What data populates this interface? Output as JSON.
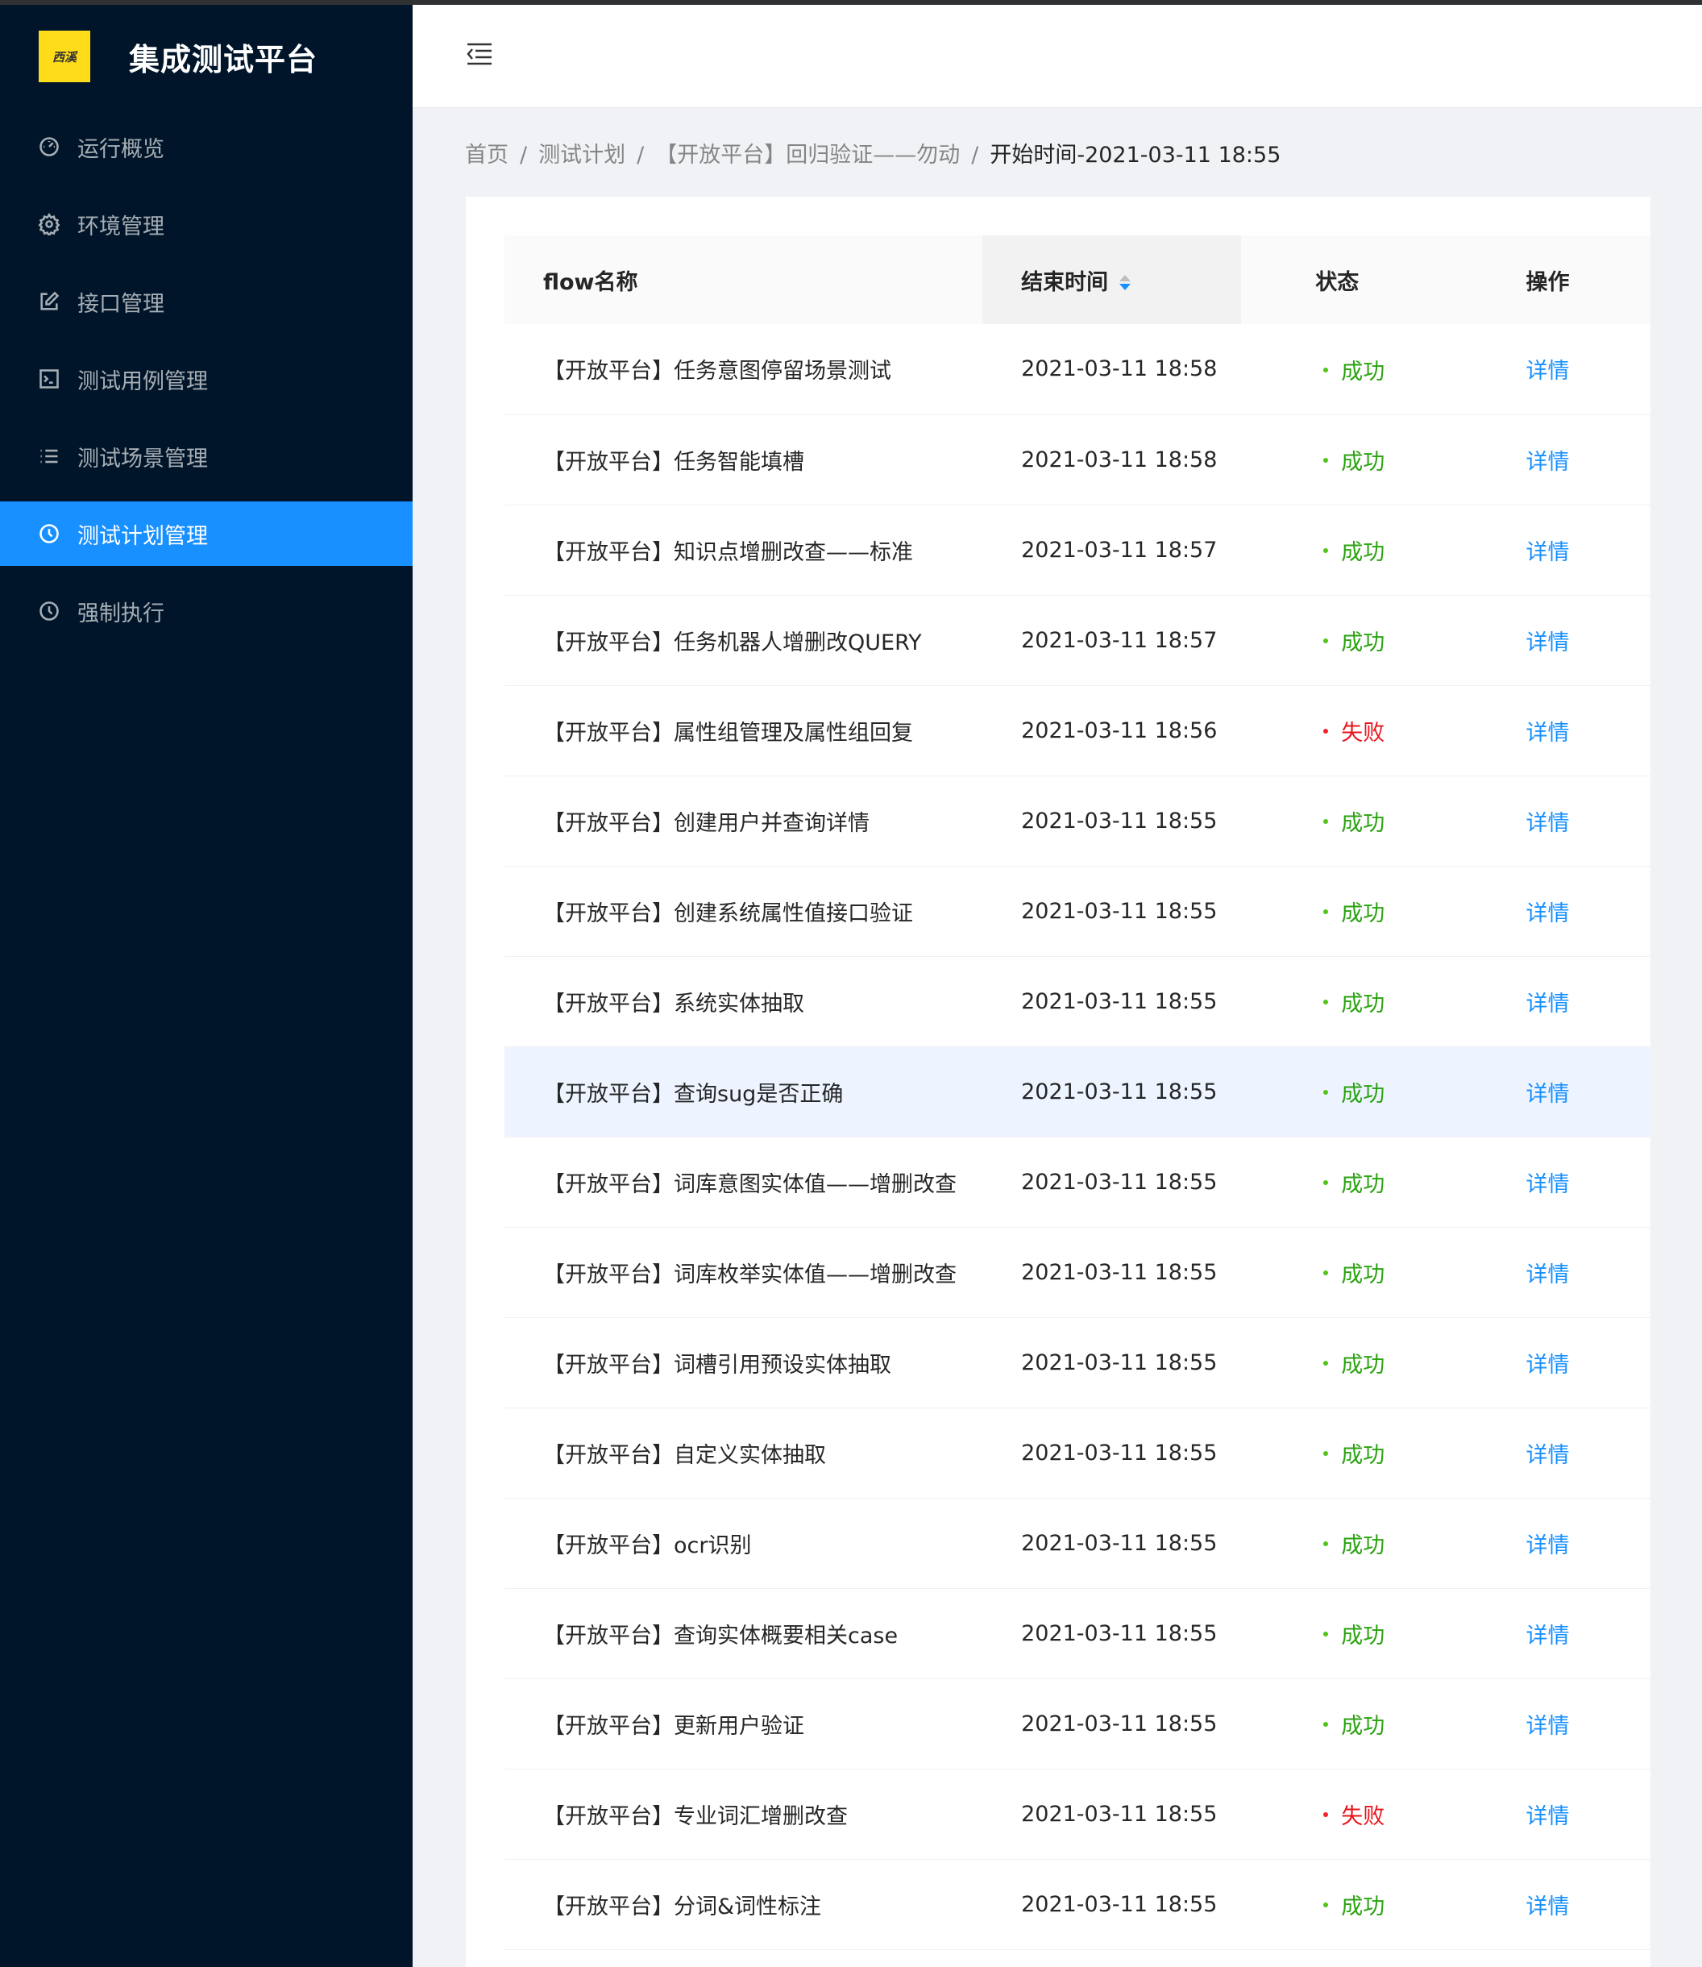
{
  "app": {
    "logo_text": "西溪",
    "title": "集成测试平台"
  },
  "sidebar": {
    "items": [
      {
        "label": "运行概览",
        "icon": "dashboard-icon",
        "active": false
      },
      {
        "label": "环境管理",
        "icon": "gear-icon",
        "active": false
      },
      {
        "label": "接口管理",
        "icon": "edit-icon",
        "active": false
      },
      {
        "label": "测试用例管理",
        "icon": "terminal-icon",
        "active": false
      },
      {
        "label": "测试场景管理",
        "icon": "list-icon",
        "active": false
      },
      {
        "label": "测试计划管理",
        "icon": "clock-icon",
        "active": true
      },
      {
        "label": "强制执行",
        "icon": "clock-icon",
        "active": false
      }
    ]
  },
  "breadcrumb": {
    "items": [
      "首页",
      "测试计划",
      "【开放平台】回归验证——勿动",
      "开始时间-2021-03-11 18:55"
    ],
    "separator": "/"
  },
  "table": {
    "columns": [
      "flow名称",
      "结束时间",
      "状态",
      "操作"
    ],
    "rows": [
      {
        "name": "【开放平台】任务意图停留场景测试",
        "time": "2021-03-11 18:58",
        "status": "成功",
        "action": "详情"
      },
      {
        "name": "【开放平台】任务智能填槽",
        "time": "2021-03-11 18:58",
        "status": "成功",
        "action": "详情"
      },
      {
        "name": "【开放平台】知识点增删改查——标准",
        "time": "2021-03-11 18:57",
        "status": "成功",
        "action": "详情"
      },
      {
        "name": "【开放平台】任务机器人增删改QUERY",
        "time": "2021-03-11 18:57",
        "status": "成功",
        "action": "详情"
      },
      {
        "name": "【开放平台】属性组管理及属性组回复",
        "time": "2021-03-11 18:56",
        "status": "失败",
        "action": "详情"
      },
      {
        "name": "【开放平台】创建用户并查询详情",
        "time": "2021-03-11 18:55",
        "status": "成功",
        "action": "详情"
      },
      {
        "name": "【开放平台】创建系统属性值接口验证",
        "time": "2021-03-11 18:55",
        "status": "成功",
        "action": "详情"
      },
      {
        "name": "【开放平台】系统实体抽取",
        "time": "2021-03-11 18:55",
        "status": "成功",
        "action": "详情"
      },
      {
        "name": "【开放平台】查询sug是否正确",
        "time": "2021-03-11 18:55",
        "status": "成功",
        "action": "详情"
      },
      {
        "name": "【开放平台】词库意图实体值——增删改查",
        "time": "2021-03-11 18:55",
        "status": "成功",
        "action": "详情"
      },
      {
        "name": "【开放平台】词库枚举实体值——增删改查",
        "time": "2021-03-11 18:55",
        "status": "成功",
        "action": "详情"
      },
      {
        "name": "【开放平台】词槽引用预设实体抽取",
        "time": "2021-03-11 18:55",
        "status": "成功",
        "action": "详情"
      },
      {
        "name": "【开放平台】自定义实体抽取",
        "time": "2021-03-11 18:55",
        "status": "成功",
        "action": "详情"
      },
      {
        "name": "【开放平台】ocr识别",
        "time": "2021-03-11 18:55",
        "status": "成功",
        "action": "详情"
      },
      {
        "name": "【开放平台】查询实体概要相关case",
        "time": "2021-03-11 18:55",
        "status": "成功",
        "action": "详情"
      },
      {
        "name": "【开放平台】更新用户验证",
        "time": "2021-03-11 18:55",
        "status": "成功",
        "action": "详情"
      },
      {
        "name": "【开放平台】专业词汇增删改查",
        "time": "2021-03-11 18:55",
        "status": "失败",
        "action": "详情"
      },
      {
        "name": "【开放平台】分词&词性标注",
        "time": "2021-03-11 18:55",
        "status": "成功",
        "action": "详情"
      }
    ],
    "hovered_row": 8
  },
  "colors": {
    "sider_bg": "#001529",
    "primary": "#1890ff",
    "success": "#52c41a",
    "fail": "#f5222d",
    "status_success_text": "#2ba312",
    "status_fail_text": "#e8141b"
  }
}
